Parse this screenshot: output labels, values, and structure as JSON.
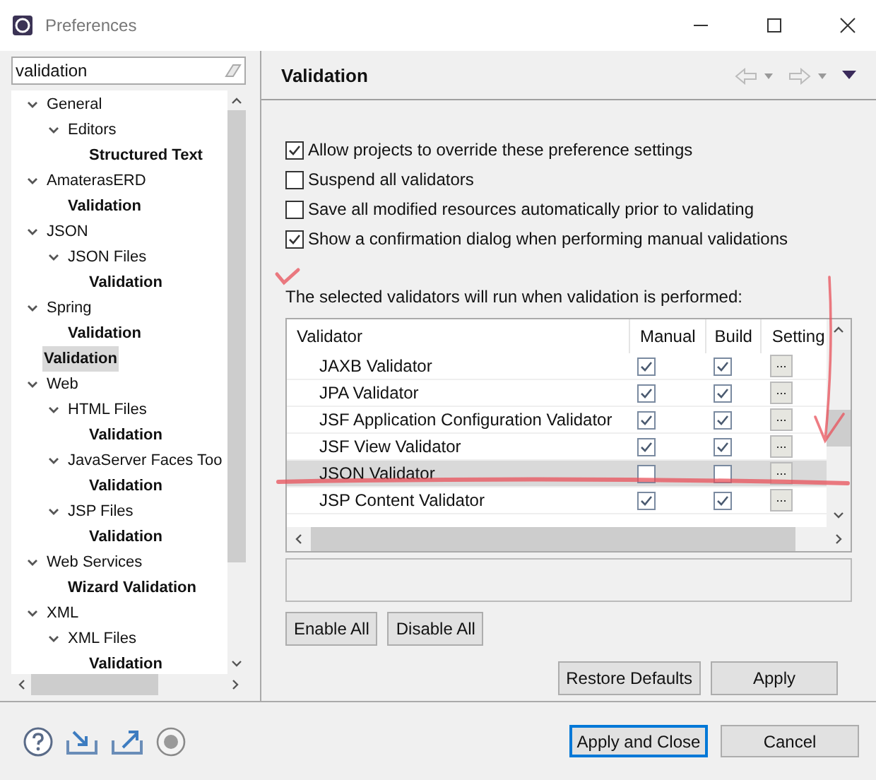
{
  "window": {
    "title": "Preferences"
  },
  "filter": {
    "value": "validation"
  },
  "tree": [
    {
      "label": "General",
      "expanded": true,
      "selected": false,
      "children": [
        {
          "label": "Editors",
          "expanded": true,
          "selected": false,
          "children": [
            {
              "label": "Structured Text",
              "selected": false
            }
          ]
        }
      ]
    },
    {
      "label": "AmaterasERD",
      "expanded": true,
      "selected": false,
      "children": [
        {
          "label": "Validation",
          "selected": false
        }
      ]
    },
    {
      "label": "JSON",
      "expanded": true,
      "selected": false,
      "children": [
        {
          "label": "JSON Files",
          "expanded": true,
          "selected": false,
          "children": [
            {
              "label": "Validation",
              "selected": false
            }
          ]
        }
      ]
    },
    {
      "label": "Spring",
      "expanded": true,
      "selected": false,
      "children": [
        {
          "label": "Validation",
          "selected": false
        }
      ]
    },
    {
      "label": "Validation",
      "selected": true
    },
    {
      "label": "Web",
      "expanded": true,
      "selected": false,
      "children": [
        {
          "label": "HTML Files",
          "expanded": true,
          "selected": false,
          "children": [
            {
              "label": "Validation",
              "selected": false
            }
          ]
        },
        {
          "label": "JavaServer Faces Too",
          "expanded": true,
          "selected": false,
          "children": [
            {
              "label": "Validation",
              "selected": false
            }
          ]
        },
        {
          "label": "JSP Files",
          "expanded": true,
          "selected": false,
          "children": [
            {
              "label": "Validation",
              "selected": false
            }
          ]
        }
      ]
    },
    {
      "label": "Web Services",
      "expanded": true,
      "selected": false,
      "children": [
        {
          "label": "Wizard Validation",
          "selected": false
        }
      ]
    },
    {
      "label": "XML",
      "expanded": true,
      "selected": false,
      "children": [
        {
          "label": "XML Files",
          "expanded": true,
          "selected": false,
          "children": [
            {
              "label": "Validation",
              "selected": false
            }
          ]
        }
      ]
    }
  ],
  "page": {
    "title": "Validation",
    "options": [
      {
        "label": "Allow projects to override these preference settings",
        "checked": true
      },
      {
        "label": "Suspend all validators",
        "checked": false
      },
      {
        "label": "Save all modified resources automatically prior to validating",
        "checked": false
      },
      {
        "label": "Show a confirmation dialog when performing manual validations",
        "checked": true
      }
    ],
    "table_intro": "The selected validators will run when validation is performed:",
    "table": {
      "columns": [
        "Validator",
        "Manual",
        "Build",
        "Setting"
      ],
      "rows": [
        {
          "name": "JAXB Validator",
          "manual": true,
          "build": true,
          "settings": "...",
          "selected": false
        },
        {
          "name": "JPA Validator",
          "manual": true,
          "build": true,
          "settings": "...",
          "selected": false
        },
        {
          "name": "JSF Application Configuration Validator",
          "manual": true,
          "build": true,
          "settings": "...",
          "selected": false
        },
        {
          "name": "JSF View Validator",
          "manual": true,
          "build": true,
          "settings": "...",
          "selected": false
        },
        {
          "name": "JSON Validator",
          "manual": false,
          "build": false,
          "settings": "...",
          "selected": true
        },
        {
          "name": "JSP Content Validator",
          "manual": true,
          "build": true,
          "settings": "...",
          "selected": false
        }
      ]
    },
    "table_buttons": [
      "Enable All",
      "Disable All"
    ],
    "page_buttons": [
      "Restore Defaults",
      "Apply"
    ]
  },
  "dialog_buttons": [
    {
      "label": "Apply and Close",
      "default": true
    },
    {
      "label": "Cancel",
      "default": false
    }
  ]
}
